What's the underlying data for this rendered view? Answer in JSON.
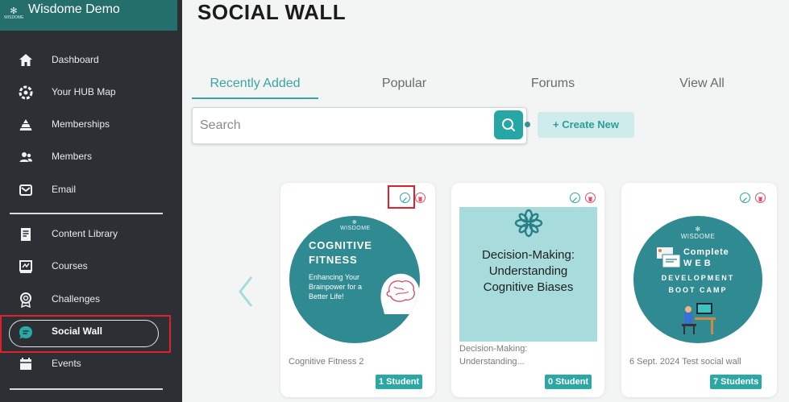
{
  "sidebar": {
    "brand": {
      "logo_text": "WISDOME",
      "name": "Wisdome Demo"
    },
    "items": [
      {
        "label": "Dashboard",
        "icon": "home-icon"
      },
      {
        "label": "Your HUB Map",
        "icon": "hub-map-icon"
      },
      {
        "label": "Memberships",
        "icon": "memberships-icon"
      },
      {
        "label": "Members",
        "icon": "members-icon"
      },
      {
        "label": "Email",
        "icon": "email-icon"
      },
      {
        "label": "Content Library",
        "icon": "content-library-icon"
      },
      {
        "label": "Courses",
        "icon": "courses-icon"
      },
      {
        "label": "Challenges",
        "icon": "challenges-icon"
      },
      {
        "label": "Social Wall",
        "icon": "social-wall-icon",
        "active": true
      },
      {
        "label": "Events",
        "icon": "events-icon"
      }
    ]
  },
  "main": {
    "title": "SOCIAL WALL",
    "tabs": [
      {
        "label": "Recently Added",
        "active": true
      },
      {
        "label": "Popular"
      },
      {
        "label": "Forums"
      },
      {
        "label": "View All"
      }
    ],
    "search": {
      "placeholder": "Search",
      "value": ""
    },
    "create_button": "+ Create New"
  },
  "cards": [
    {
      "title": "Cognitive Fitness 2",
      "badge": "1 Student",
      "image": {
        "logo": "WISDOME",
        "heading_line1": "COGNITIVE",
        "heading_line2": "FITNESS",
        "sub_line1": "Enhancing Your",
        "sub_line2": "Brainpower for a",
        "sub_line3": "Better Life!"
      }
    },
    {
      "title_line1": "Decision-Making:",
      "title_line2": "Understanding...",
      "badge": "0 Student",
      "image": {
        "line1": "Decision-Making:",
        "line2": "Understanding",
        "line3": "Cognitive Biases"
      }
    },
    {
      "title": "6 Sept. 2024 Test social wall",
      "badge": "7 Students",
      "image": {
        "logo": "WISDOME",
        "line1": "Complete",
        "line2": "WEB",
        "line3": "DEVELOPMENT",
        "line4": "BOOT CAMP"
      }
    }
  ],
  "colors": {
    "sidebar_bg": "#2c3034",
    "brand_bg": "#246e6c",
    "accent": "#2aa8a4",
    "highlight": "#e0202a"
  }
}
